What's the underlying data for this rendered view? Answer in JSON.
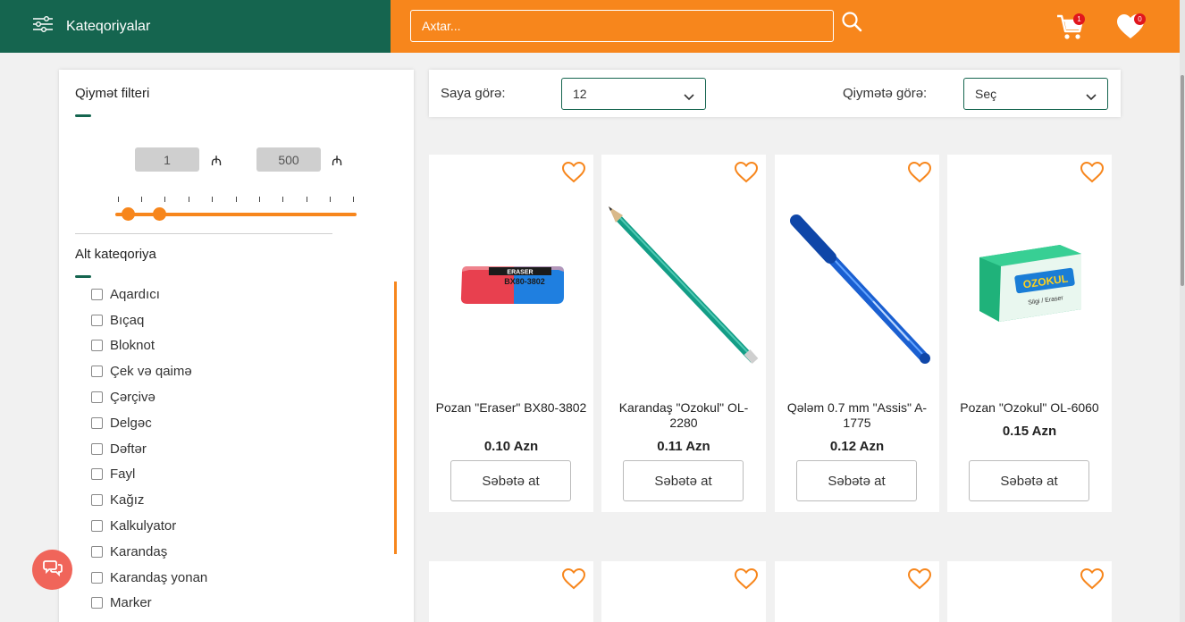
{
  "header": {
    "categories_label": "Kateqoriyalar",
    "search_placeholder": "Axtar...",
    "cart_count": "1",
    "favorites_count": "0",
    "accent_green": "#15654f",
    "accent_orange": "#f7861c"
  },
  "sidebar": {
    "price_filter_title": "Qiymət filteri",
    "price_min": "1",
    "price_max": "500",
    "currency_symbol": "₼",
    "subcategory_title": "Alt kateqoriya",
    "categories": [
      "Aqardıcı",
      "Bıçaq",
      "Bloknot",
      "Çek və qaimə",
      "Çərçivə",
      "Delgəc",
      "Dəftər",
      "Fayl",
      "Kağız",
      "Kalkulyator",
      "Karandaş",
      "Karandaş yonan",
      "Marker"
    ]
  },
  "toolbar": {
    "count_label": "Saya görə:",
    "count_value": "12",
    "price_label": "Qiymətə görə:",
    "price_value": "Seç"
  },
  "products": [
    {
      "name": "Pozan \"Eraser\" BX80-3802",
      "price": "0.10 Azn",
      "button": "Səbətə at"
    },
    {
      "name": "Karandaş \"Ozokul\" OL-2280",
      "price": "0.11 Azn",
      "button": "Səbətə at"
    },
    {
      "name": "Qələm 0.7 mm \"Assis\" A-1775",
      "price": "0.12 Azn",
      "button": "Səbətə at"
    },
    {
      "name": "Pozan \"Ozokul\" OL-6060",
      "price": "0.15 Azn",
      "button": "Səbətə at"
    }
  ],
  "product_images": {
    "eraser_label": "ERASER",
    "eraser_code": "BX80-3802",
    "ozokul_brand": "OZOKUL",
    "ozokul_sub": "Silgi / Eraser"
  }
}
